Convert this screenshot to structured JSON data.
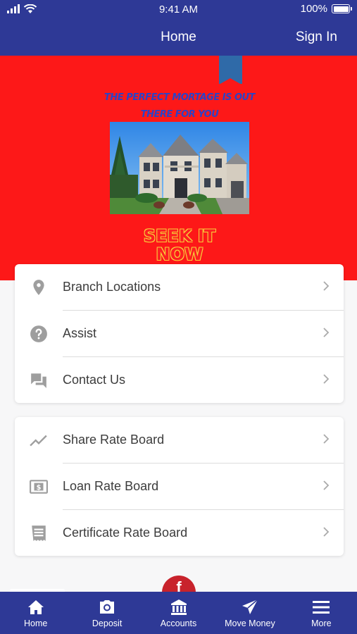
{
  "status": {
    "time": "9:41 AM",
    "battery": "100%"
  },
  "header": {
    "title": "Home",
    "sign_in": "Sign In"
  },
  "hero": {
    "tagline_line1": "THE PERFECT MORTAGE IS OUT",
    "tagline_line2": "THERE FOR YOU",
    "cta_line1": "SEEK IT",
    "cta_line2": "NOW",
    "background_color": "#fd1818"
  },
  "menu_group_1": [
    {
      "label": "Branch Locations",
      "icon": "location-pin-icon"
    },
    {
      "label": "Assist",
      "icon": "help-circle-icon"
    },
    {
      "label": "Contact Us",
      "icon": "chat-bubbles-icon"
    }
  ],
  "menu_group_2": [
    {
      "label": "Share Rate Board",
      "icon": "trend-line-icon"
    },
    {
      "label": "Loan Rate Board",
      "icon": "dollar-bill-icon"
    },
    {
      "label": "Certificate Rate Board",
      "icon": "certificate-icon"
    }
  ],
  "tabs": [
    {
      "label": "Home",
      "icon": "home-icon"
    },
    {
      "label": "Deposit",
      "icon": "camera-icon"
    },
    {
      "label": "Accounts",
      "icon": "bank-icon"
    },
    {
      "label": "Move Money",
      "icon": "send-icon"
    },
    {
      "label": "More",
      "icon": "menu-icon"
    }
  ],
  "colors": {
    "brand_navy": "#2e3996",
    "hero_red": "#fd1818",
    "tagline_blue": "#2b43c6",
    "facebook_red": "#c8232c"
  }
}
